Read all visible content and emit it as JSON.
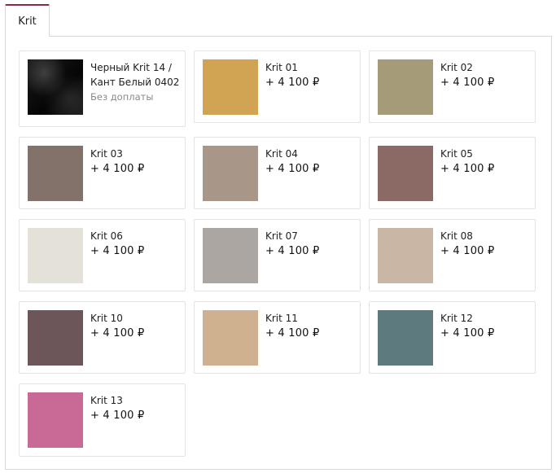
{
  "tabs": [
    {
      "label": "Krit"
    }
  ],
  "items": [
    {
      "name": "Черный Krit 14 / Кант Белый 0402",
      "note": "Без доплаты",
      "swatch_color": "#111111"
    },
    {
      "name": "Krit 01",
      "price": "+ 4 100 ₽",
      "swatch_color": "#d1a453"
    },
    {
      "name": "Krit 02",
      "price": "+ 4 100 ₽",
      "swatch_color": "#a59b79"
    },
    {
      "name": "Krit 03",
      "price": "+ 4 100 ₽",
      "swatch_color": "#837269"
    },
    {
      "name": "Krit 04",
      "price": "+ 4 100 ₽",
      "swatch_color": "#a89688"
    },
    {
      "name": "Krit 05",
      "price": "+ 4 100 ₽",
      "swatch_color": "#8b6a66"
    },
    {
      "name": "Krit 06",
      "price": "+ 4 100 ₽",
      "swatch_color": "#e3e1d8"
    },
    {
      "name": "Krit 07",
      "price": "+ 4 100 ₽",
      "swatch_color": "#aba6a2"
    },
    {
      "name": "Krit 08",
      "price": "+ 4 100 ₽",
      "swatch_color": "#c9b6a5"
    },
    {
      "name": "Krit 10",
      "price": "+ 4 100 ₽",
      "swatch_color": "#6c565a"
    },
    {
      "name": "Krit 11",
      "price": "+ 4 100 ₽",
      "swatch_color": "#cfb18f"
    },
    {
      "name": "Krit 12",
      "price": "+ 4 100 ₽",
      "swatch_color": "#5d7a7f"
    },
    {
      "name": "Krit 13",
      "price": "+ 4 100 ₽",
      "swatch_color": "#c86a95"
    }
  ]
}
